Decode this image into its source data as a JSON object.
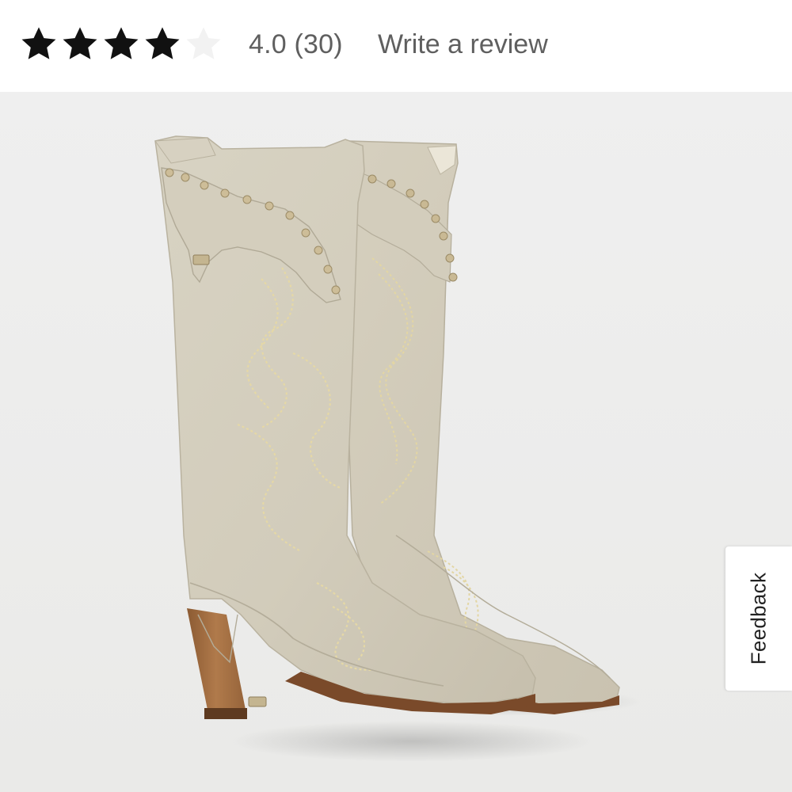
{
  "rating": {
    "value": 4.0,
    "max": 5,
    "filled_stars": 4,
    "score_text": "4.0 (30)",
    "write_review_label": "Write a review",
    "star_filled_color": "#111111",
    "star_empty_color": "#f2f2f2"
  },
  "product_image": {
    "subject": "boots-image",
    "background_color": "#eeeeee"
  },
  "feedback": {
    "label": "Feedback"
  }
}
